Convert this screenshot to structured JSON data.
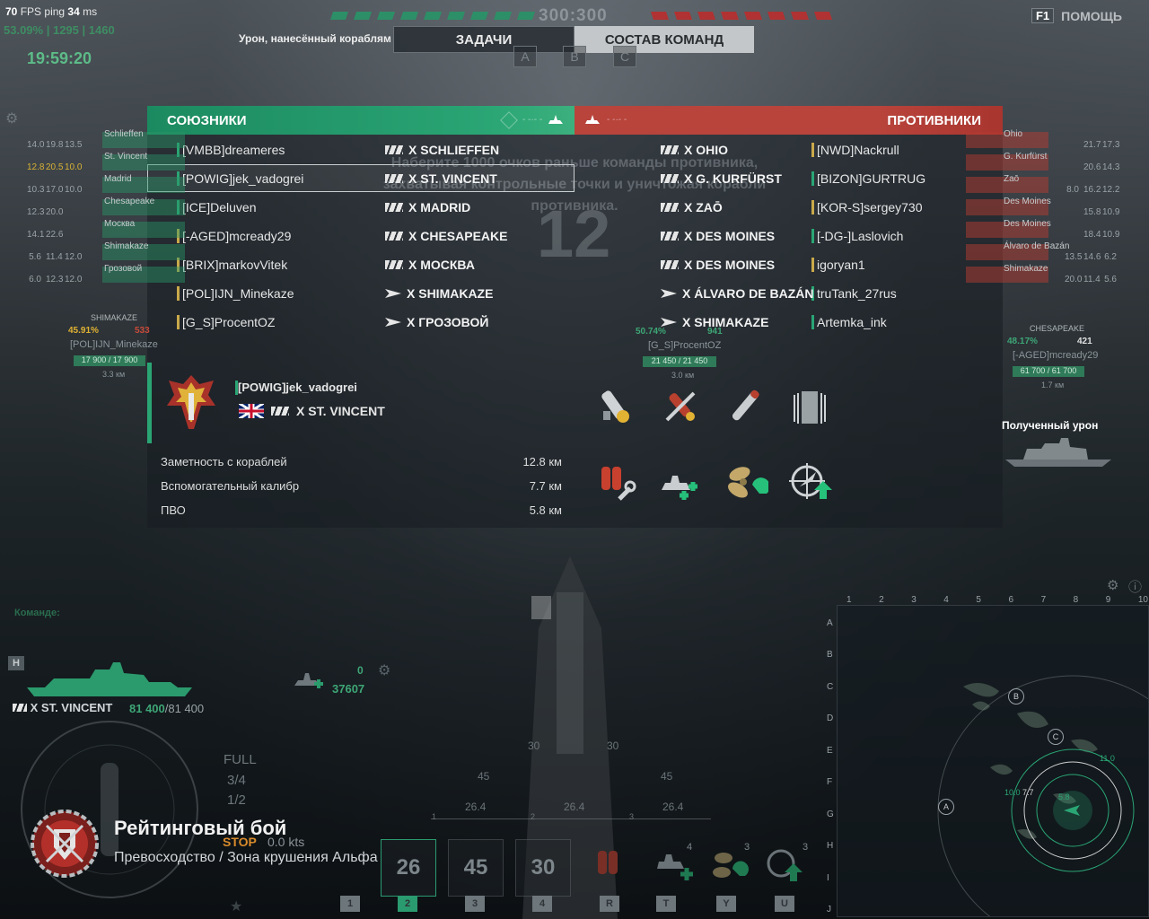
{
  "hud": {
    "fps": "70",
    "fps_label": "FPS",
    "ping_label": "ping",
    "ping": "34",
    "ping_unit": "ms",
    "ratio": "53.09%",
    "ratio_a": "1295",
    "ratio_b": "1460",
    "clock": "19:59:20",
    "score_ally": "300",
    "score_sep": ":",
    "score_enemy": "300",
    "help_key": "F1",
    "help_label": "ПОМОЩЬ"
  },
  "tabs": {
    "damage_label": "Урон, нанесённый кораблям",
    "tasks": "ЗАДАЧИ",
    "teams": "СОСТАВ КОМАНД",
    "cap_points": [
      "A",
      "B",
      "C"
    ]
  },
  "objective_text": "Наберите 1000 очков раньше команды противника, захватывая контрольные точки и уничтожая корабли противника.",
  "timer_big": "12",
  "allies": {
    "title": "СОЮЗНИКИ",
    "rows": [
      {
        "player": "[VMBB]dreameres",
        "ship": "X  SCHLIEFFEN",
        "cls": "bb",
        "bar": "#2aa574"
      },
      {
        "player": "[POWIG]jek_vadogrei",
        "ship": "X  ST. VINCENT",
        "cls": "bb",
        "bar": "#2aa574"
      },
      {
        "player": "[ICE]Deluven",
        "ship": "X  MADRID",
        "cls": "bb",
        "bar": "#2aa574"
      },
      {
        "player": "[-AGED]mcready29",
        "ship": "X  CHESAPEAKE",
        "cls": "bb",
        "bar": "#c9a94a"
      },
      {
        "player": "[BRIX]markovVitek",
        "ship": "X  МОСКВА",
        "cls": "bb",
        "bar": "#c9a94a"
      },
      {
        "player": "[POL]IJN_Minekaze",
        "ship": "X  SHIMAKAZE",
        "cls": "dd",
        "bar": "#c9a94a"
      },
      {
        "player": "[G_S]ProcentOZ",
        "ship": "X  ГРОЗОВОЙ",
        "cls": "dd",
        "bar": "#c9a94a"
      }
    ]
  },
  "enemies": {
    "title": "ПРОТИВНИКИ",
    "rows": [
      {
        "player": "[NWD]Nackrull",
        "ship": "X  OHIO",
        "cls": "bb",
        "bar": "#c9a94a"
      },
      {
        "player": "[BIZON]GURTRUG",
        "ship": "X  G. KURFÜRST",
        "cls": "bb",
        "bar": "#2aa574"
      },
      {
        "player": "[KOR-S]sergey730",
        "ship": "X  ZAŌ",
        "cls": "bb",
        "bar": "#c9a94a"
      },
      {
        "player": "[-DG-]Laslovich",
        "ship": "X  DES MOINES",
        "cls": "bb",
        "bar": "#2aa574"
      },
      {
        "player": "igoryan1",
        "ship": "X  DES MOINES",
        "cls": "bb",
        "bar": "#c9a94a"
      },
      {
        "player": "truTank_27rus",
        "ship": "X  ÁLVARO DE BAZÁN",
        "cls": "dd",
        "bar": "#2aa574"
      },
      {
        "player": "Artemka_ink",
        "ship": "X  SHIMAKAZE",
        "cls": "dd",
        "bar": "#2aa574"
      }
    ]
  },
  "player_detail": {
    "name": "[POWIG]jek_vadogrei",
    "ship": "X  ST. VINCENT",
    "stats": [
      {
        "label": "Заметность с кораблей",
        "value": "12.8 км"
      },
      {
        "label": "Вспомогательный калибр",
        "value": "7.7 км"
      },
      {
        "label": "ПВО",
        "value": "5.8 км"
      }
    ],
    "consumable_icons": [
      "damage-control-icon",
      "ap-shell-icon",
      "he-shell-icon",
      "armor-mod-icon"
    ],
    "upgrade_icons": [
      "repair-party-icon",
      "main-battery-mod-icon",
      "propulsion-mod-icon",
      "aa-guidance-icon"
    ]
  },
  "received_damage_label": "Полученный урон",
  "side_ally_ships": [
    "Schlieffen",
    "St. Vincent",
    "Madrid",
    "Chesapeake",
    "Москва",
    "Shimakaze",
    "Грозовой"
  ],
  "side_ally_stats": [
    [
      "14.0",
      "19.8",
      "13.5"
    ],
    [
      "12.8",
      "20.5",
      "10.0"
    ],
    [
      "10.3",
      "17.0",
      "10.0"
    ],
    [
      "12.3",
      "20.0",
      ""
    ],
    [
      "14.1",
      "22.6",
      ""
    ],
    [
      "5.6",
      "11.4",
      "12.0"
    ],
    [
      "6.0",
      "12.3",
      "12.0"
    ]
  ],
  "side_enemy_ships": [
    "Ohio",
    "G. Kurfürst",
    "Zaō",
    "Des Moines",
    "Des Moines",
    "Álvaro de Bazán",
    "Shimakaze"
  ],
  "side_enemy_stats": [
    [
      "",
      "21.7",
      "17.3"
    ],
    [
      "",
      "20.6",
      "14.3"
    ],
    [
      "8.0",
      "16.2",
      "12.2"
    ],
    [
      "",
      "15.8",
      "10.9"
    ],
    [
      "",
      "18.4",
      "10.9"
    ],
    [
      "13.5",
      "14.6",
      "6.2"
    ],
    [
      "20.0",
      "11.4",
      "5.6"
    ]
  ],
  "markers": {
    "shimakaze_label": "SHIMAKAZE",
    "shimakaze_pct": "45.91%",
    "shimakaze_hp_extra": "533",
    "shimakaze_player": "[POL]IJN_Minekaze",
    "shimakaze_hp": "17 900 / 17 900",
    "shimakaze_dist": "3.3 км",
    "procent_pct": "50.74%",
    "procent_extra": "941",
    "procent_player": "[G_S]ProcentOZ",
    "procent_hp": "21 450 / 21 450",
    "procent_dist": "3.0 км",
    "chesapeake_label": "CHESAPEAKE",
    "chesapeake_pct": "48.17%",
    "chesapeake_extra": "421",
    "chesapeake_player": "[-AGED]mcready29",
    "chesapeake_hp": "61 700 / 61 700",
    "chesapeake_dist": "1.7 км"
  },
  "own": {
    "tag": "Команде:",
    "class_key": "H",
    "ship": "X ST. VINCENT",
    "hp": "81 400",
    "hp_max": "/81 400",
    "damage_top": "0",
    "damage": "37607",
    "speed_full": "FULL",
    "speed_34": "3/4",
    "speed_12": "1/2",
    "speed_stop": "STOP",
    "speed_value": "0.0 kts"
  },
  "crosshair": {
    "marks": [
      "30",
      "30",
      "45",
      "45",
      "26.4",
      "26.4",
      "26.4"
    ],
    "markers": [
      "1",
      "2",
      "3"
    ]
  },
  "battle": {
    "title": "Рейтинговый бой",
    "subtitle": "Превосходство / Зона крушения Альфа"
  },
  "toolbar": {
    "slots": [
      "26",
      "45",
      "30",
      "",
      "",
      "",
      ""
    ],
    "counts": [
      "",
      "",
      "",
      "",
      "4",
      "3",
      "3"
    ],
    "keys": [
      "1",
      "2",
      "3",
      "4",
      "R",
      "T",
      "Y",
      "U"
    ]
  },
  "minimap": {
    "cols": [
      "1",
      "2",
      "3",
      "4",
      "5",
      "6",
      "7",
      "8",
      "9",
      "10"
    ],
    "rows": [
      "A",
      "B",
      "C",
      "D",
      "E",
      "F",
      "G",
      "H",
      "I",
      "J"
    ],
    "cap_points": [
      "A",
      "B",
      "C"
    ],
    "ring_labels": [
      "11.0",
      "10.0",
      "7.7",
      "5.8"
    ]
  }
}
